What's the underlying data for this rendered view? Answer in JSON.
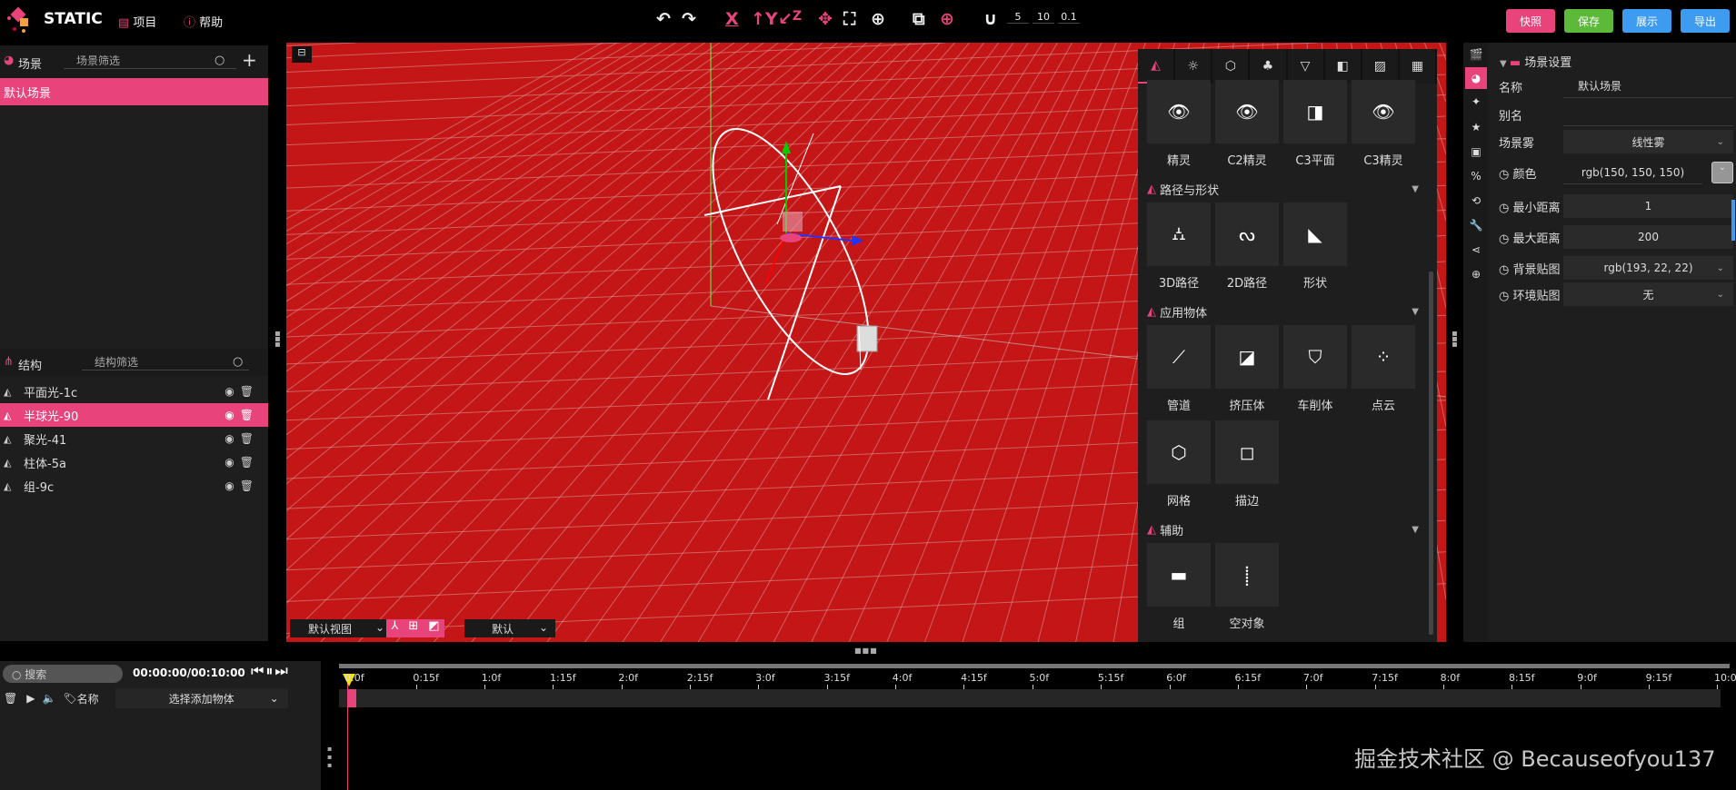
{
  "app": {
    "name": "STATIC",
    "menu": [
      {
        "label": "项目",
        "icon": "project-icon"
      },
      {
        "label": "帮助",
        "icon": "help-icon"
      }
    ]
  },
  "toolbar": {
    "undo": "undo-icon",
    "redo": "redo-icon",
    "axes": [
      "X",
      "Y",
      "Z"
    ],
    "snap_values": [
      "5",
      "10",
      "0.1"
    ],
    "buttons": [
      {
        "label": "快照",
        "color": "#e8437a"
      },
      {
        "label": "保存",
        "color": "#5cb93a"
      },
      {
        "label": "展示",
        "color": "#3d9cf0"
      },
      {
        "label": "导出",
        "color": "#3d9cf0"
      }
    ]
  },
  "scene_panel": {
    "title": "场景",
    "filter_placeholder": "场景筛选",
    "items": [
      "默认场景"
    ]
  },
  "structure_panel": {
    "title": "结构",
    "filter_placeholder": "结构筛选",
    "items": [
      {
        "label": "平面光-1c",
        "selected": false
      },
      {
        "label": "半球光-90",
        "selected": true
      },
      {
        "label": "聚光-41",
        "selected": false
      },
      {
        "label": "柱体-5a",
        "selected": false
      },
      {
        "label": "组-9c",
        "selected": false
      }
    ]
  },
  "viewport": {
    "background": "#c41616",
    "view_select": "默认视图",
    "mode_select": "默认"
  },
  "object_panel": {
    "sections": [
      {
        "title": "",
        "items": [
          "精灵",
          "C2精灵",
          "C3平面",
          "C3精灵"
        ]
      },
      {
        "title": "路径与形状",
        "items": [
          "3D路径",
          "2D路径",
          "形状"
        ]
      },
      {
        "title": "应用物体",
        "items": [
          "管道",
          "挤压体",
          "车削体",
          "点云",
          "网格",
          "描边"
        ]
      },
      {
        "title": "辅助",
        "items": [
          "组",
          "空对象"
        ]
      }
    ]
  },
  "properties": {
    "section": "场景设置",
    "fields": [
      {
        "label": "名称",
        "value": "默认场景"
      },
      {
        "label": "别名",
        "value": ""
      },
      {
        "label": "场景雾",
        "value": "线性雾"
      },
      {
        "label": "颜色",
        "value": "rgb(150, 150, 150)"
      },
      {
        "label": "最小距离",
        "value": "1"
      },
      {
        "label": "最大距离",
        "value": "200"
      },
      {
        "label": "背景贴图",
        "value": "rgb(193, 22, 22)"
      },
      {
        "label": "环境贴图",
        "value": "无"
      }
    ]
  },
  "timeline": {
    "search_placeholder": "搜索",
    "time": "00:00:00/00:10:00",
    "name_label": "名称",
    "add_object": "选择添加物体",
    "ticks": [
      "0:0f",
      "0:15f",
      "1:0f",
      "1:15f",
      "2:0f",
      "2:15f",
      "3:0f",
      "3:15f",
      "4:0f",
      "4:15f",
      "5:0f",
      "5:15f",
      "6:0f",
      "6:15f",
      "7:0f",
      "7:15f",
      "8:0f",
      "8:15f",
      "9:0f",
      "9:15f",
      "10:0"
    ]
  },
  "watermark": "掘金技术社区 @ Becauseofyou137"
}
